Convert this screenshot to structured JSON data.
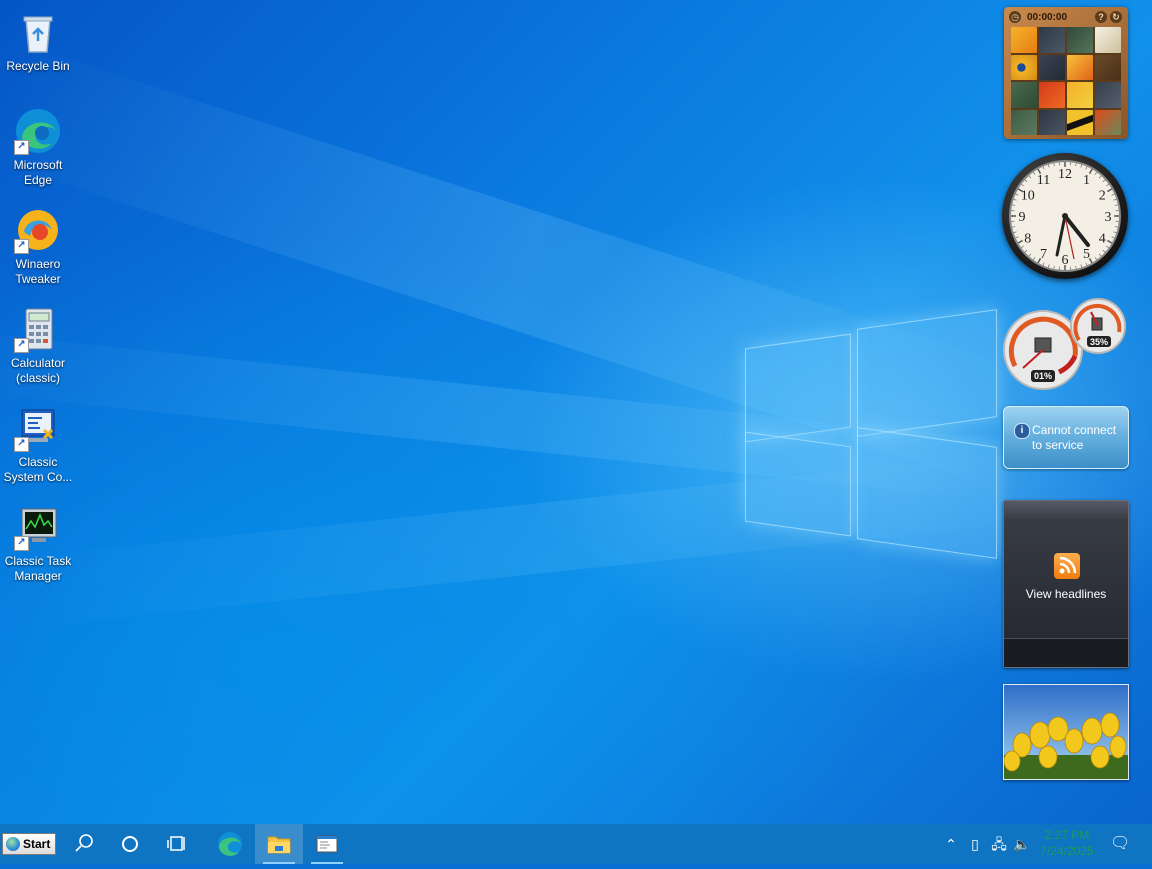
{
  "desktop": {
    "icons": [
      {
        "label": "Recycle Bin",
        "icon": "recycle-bin-icon",
        "shortcut": false
      },
      {
        "label": "Microsoft\nEdge",
        "icon": "edge-icon",
        "shortcut": true
      },
      {
        "label": "Winaero\nTweaker",
        "icon": "winaero-tweaker-icon",
        "shortcut": true
      },
      {
        "label": "Calculator\n(classic)",
        "icon": "calculator-icon",
        "shortcut": true
      },
      {
        "label": "Classic\nSystem Co...",
        "icon": "system-config-icon",
        "shortcut": true
      },
      {
        "label": "Classic Task\nManager",
        "icon": "task-manager-icon",
        "shortcut": true
      }
    ]
  },
  "gadgets": {
    "puzzle": {
      "timer": "00:00:00",
      "icon": "picture-puzzle-icon"
    },
    "clock": {
      "numerals": [
        "12",
        "1",
        "2",
        "3",
        "4",
        "5",
        "6",
        "7",
        "8",
        "9",
        "10",
        "11"
      ],
      "time": "5:27"
    },
    "meter": {
      "cpu": "01%",
      "ram": "35%"
    },
    "weather": {
      "message": "Cannot connect to service",
      "message_line1": "Cannot connect",
      "message_line2": "to service"
    },
    "feed": {
      "label": "View headlines"
    },
    "slideshow": {
      "icon": "tulips-photo"
    }
  },
  "taskbar": {
    "start_label": "Start",
    "buttons": [
      "search-icon",
      "cortana-icon",
      "task-view-icon",
      "edge-icon",
      "file-explorer-icon",
      "notepad-icon"
    ],
    "tray": {
      "clock_line1": "2:27 PM",
      "clock_line2": "7/24/2025"
    },
    "colors": {
      "bar": "#0f74c2",
      "clock_text": "#1e9a5a"
    }
  }
}
